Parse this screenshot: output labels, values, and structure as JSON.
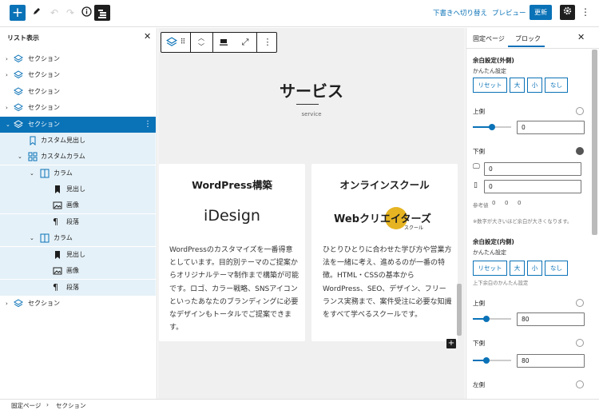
{
  "topbar": {
    "add_icon": "plus-icon",
    "draft_link": "下書きへ切り替え",
    "preview_link": "プレビュー",
    "update_button": "更新"
  },
  "list_view": {
    "title": "リスト表示",
    "items": [
      {
        "label": "セクション"
      },
      {
        "label": "セクション"
      },
      {
        "label": "セクション"
      },
      {
        "label": "セクション"
      },
      {
        "label": "セクション"
      },
      {
        "label": "カスタム見出し"
      },
      {
        "label": "カスタムカラム"
      },
      {
        "label": "カラム"
      },
      {
        "label": "見出し"
      },
      {
        "label": "画像"
      },
      {
        "label": "段落"
      },
      {
        "label": "カラム"
      },
      {
        "label": "見出し"
      },
      {
        "label": "画像"
      },
      {
        "label": "段落"
      },
      {
        "label": "セクション"
      }
    ]
  },
  "canvas": {
    "heading": "サービス",
    "subheading": "service",
    "cards": [
      {
        "title": "WordPress構築",
        "logo_text": "iDesign",
        "body": "WordPressのカスタマイズを一番得意としています。目的別テーマのご提案からオリジナルテーマ制作まで構築が可能です。ロゴ、カラー戦略、SNSアイコンといったあなたのブランディングに必要なデザインもトータルでご提案できます。"
      },
      {
        "title": "オンラインスクール",
        "logo_text": "Webクリエイターズ",
        "logo_sub": "スクール",
        "body": "ひとりひとりに合わせた学び方や営業方法を一緒に考え、進めるのが一番の特徴。HTML・CSSの基本からWordPress、SEO、デザイン、フリーランス実務まで、案件受注に必要な知識をすべて学べるスクールです。"
      }
    ]
  },
  "settings": {
    "tab_page": "固定ページ",
    "tab_block": "ブロック",
    "outer": {
      "title": "余白設定(外側)",
      "easy_label": "かんたん設定",
      "buttons": [
        "リセット",
        "大",
        "小",
        "なし"
      ],
      "top_label": "上側",
      "top_value": "0",
      "top_level": 0,
      "bottom_label": "下側",
      "bottom_pc": "0",
      "bottom_sp": "0",
      "ref_label": "参考値",
      "ref_values": [
        "0",
        "0",
        "0"
      ],
      "note": "※数字が大きいほど余白が大きくなります。"
    },
    "inner": {
      "title": "余白設定(内側)",
      "easy_label": "かんたん設定",
      "buttons": [
        "リセット",
        "大",
        "小",
        "なし"
      ],
      "note": "上下余白のかんたん設定",
      "top_label": "上側",
      "top_value": "80",
      "bottom_label": "下側",
      "bottom_value": "80",
      "left_label": "左側"
    }
  },
  "footer": {
    "crumb1": "固定ページ",
    "crumb2": "セクション"
  }
}
